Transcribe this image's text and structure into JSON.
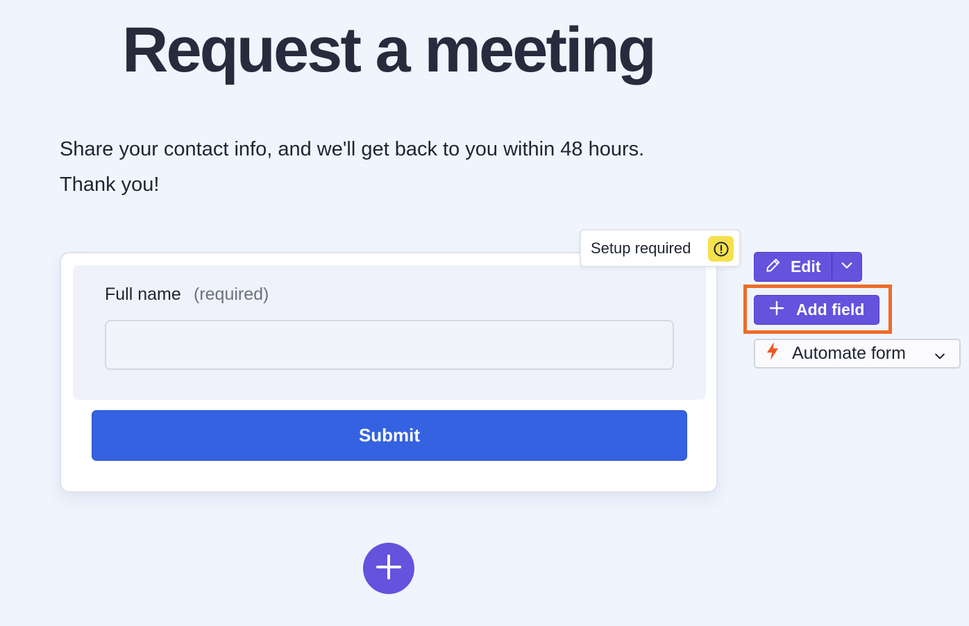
{
  "page": {
    "title": "Request a meeting",
    "description_line1": "Share your contact info, and we'll get back to you within 48 hours.",
    "description_line2": "Thank you!"
  },
  "form": {
    "field_label": "Full name",
    "field_required": "(required)",
    "field_value": "",
    "submit_label": "Submit"
  },
  "badge": {
    "setup_text": "Setup required",
    "icon": "alert-circle-icon"
  },
  "toolbar": {
    "edit_label": "Edit",
    "add_field_label": "Add field",
    "automate_label": "Automate form"
  },
  "colors": {
    "background": "#eff4fd",
    "primary_button": "#3462e0",
    "accent_purple": "#6552dd",
    "highlight_orange": "#ee6b2a",
    "warning_yellow": "#f5e14d",
    "bolt_orange": "#ef5a2a"
  }
}
